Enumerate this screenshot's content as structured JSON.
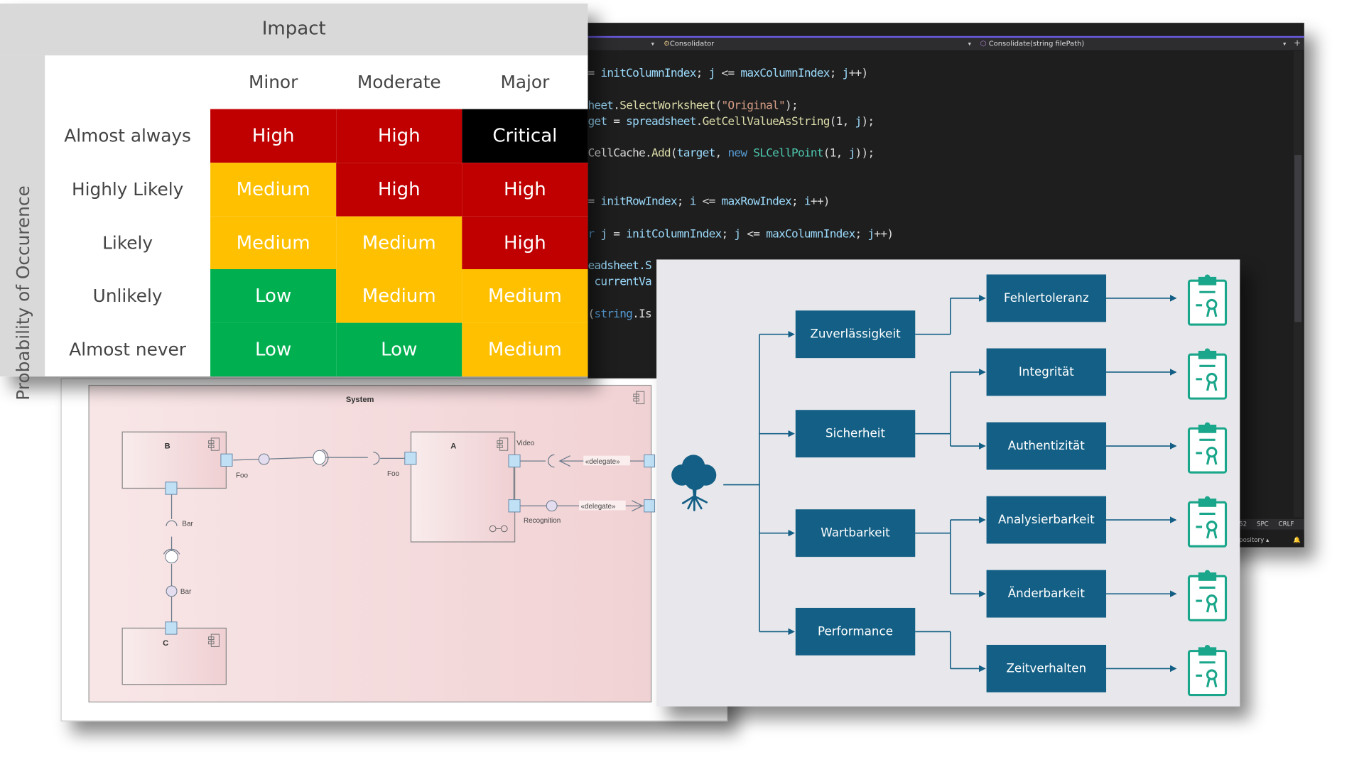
{
  "risk_matrix": {
    "header": "Impact",
    "side_label": "Probability of Occurence",
    "columns": [
      "Minor",
      "Moderate",
      "Major"
    ],
    "rows": [
      {
        "label": "Almost always",
        "cells": [
          "High",
          "High",
          "Critical"
        ]
      },
      {
        "label": "Highly Likely",
        "cells": [
          "Medium",
          "High",
          "High"
        ]
      },
      {
        "label": "Likely",
        "cells": [
          "Medium",
          "Medium",
          "High"
        ]
      },
      {
        "label": "Unlikely",
        "cells": [
          "Low",
          "Medium",
          "Medium"
        ]
      },
      {
        "label": "Almost never",
        "cells": [
          "Low",
          "Low",
          "Medium"
        ]
      }
    ],
    "colors": {
      "Critical": "#000000",
      "High": "#c00000",
      "Medium": "#ffc000",
      "Low": "#00b050"
    }
  },
  "code_editor": {
    "nav_class": "Consolidator",
    "nav_method": "Consolidate(string filePath)",
    "lines": [
      [
        [
          "= ",
          "p"
        ],
        [
          "initColumnIndex",
          "id"
        ],
        [
          "; ",
          "p"
        ],
        [
          "j",
          "id"
        ],
        [
          " <= ",
          "p"
        ],
        [
          "maxColumnIndex",
          "id"
        ],
        [
          "; ",
          "p"
        ],
        [
          "j",
          "id"
        ],
        [
          "++)",
          "p"
        ]
      ],
      [
        [
          "heet",
          "id"
        ],
        [
          ".",
          "p"
        ],
        [
          "SelectWorksheet",
          "fn"
        ],
        [
          "(",
          "p"
        ],
        [
          "\"Original\"",
          "str"
        ],
        [
          ");",
          "p"
        ]
      ],
      [
        [
          "get",
          "id"
        ],
        [
          " = ",
          "p"
        ],
        [
          "spreadsheet",
          "id"
        ],
        [
          ".",
          "p"
        ],
        [
          "GetCellValueAsString",
          "fn"
        ],
        [
          "(1, ",
          "p"
        ],
        [
          "j",
          "id"
        ],
        [
          ");",
          "p"
        ]
      ],
      [
        [
          "CellCache",
          "p"
        ],
        [
          ".",
          "p"
        ],
        [
          "Add",
          "fn"
        ],
        [
          "(",
          "p"
        ],
        [
          "target",
          "id"
        ],
        [
          ", ",
          "p"
        ],
        [
          "new ",
          "kw"
        ],
        [
          "SLCellPoint",
          "ty"
        ],
        [
          "(1, ",
          "p"
        ],
        [
          "j",
          "id"
        ],
        [
          "));",
          "p"
        ]
      ],
      [
        [
          "= ",
          "p"
        ],
        [
          "initRowIndex",
          "id"
        ],
        [
          "; ",
          "p"
        ],
        [
          "i",
          "id"
        ],
        [
          " <= ",
          "p"
        ],
        [
          "maxRowIndex",
          "id"
        ],
        [
          "; ",
          "p"
        ],
        [
          "i",
          "id"
        ],
        [
          "++)",
          "p"
        ]
      ],
      [
        [
          "r ",
          "kw"
        ],
        [
          "j",
          "id"
        ],
        [
          " = ",
          "p"
        ],
        [
          "initColumnIndex",
          "id"
        ],
        [
          "; ",
          "p"
        ],
        [
          "j",
          "id"
        ],
        [
          " <= ",
          "p"
        ],
        [
          "maxColumnIndex",
          "id"
        ],
        [
          "; ",
          "p"
        ],
        [
          "j",
          "id"
        ],
        [
          "++)",
          "p"
        ]
      ],
      [
        [
          "eadsheet.S",
          "id"
        ]
      ],
      [
        [
          " currentVa",
          "id"
        ]
      ],
      [
        [
          "(",
          "p"
        ],
        [
          "string",
          "kw"
        ],
        [
          ".Is",
          "p"
        ]
      ]
    ],
    "status": {
      "col": "52",
      "indent": "SPC",
      "eol": "CRLF",
      "repo": "pository"
    }
  },
  "uml": {
    "system": "System",
    "components": {
      "b": "B",
      "a": "A",
      "c": "C"
    },
    "labels": {
      "foo1": "Foo",
      "foo2": "Foo",
      "video": "Video",
      "recognition": "Recognition",
      "bar1": "Bar",
      "bar2": "Bar",
      "delegate1": "«delegate»",
      "delegate2": "«delegate»"
    }
  },
  "quality_tree": {
    "color": "#135f85",
    "icon_color": "#1aa68a",
    "categories": [
      "Zuverlässigkeit",
      "Sicherheit",
      "Wartbarkeit",
      "Performance"
    ],
    "attributes": [
      "Fehlertoleranz",
      "Integrität",
      "Authentizität",
      "Analysierbarkeit",
      "Änderbarkeit",
      "Zeitverhalten"
    ]
  }
}
